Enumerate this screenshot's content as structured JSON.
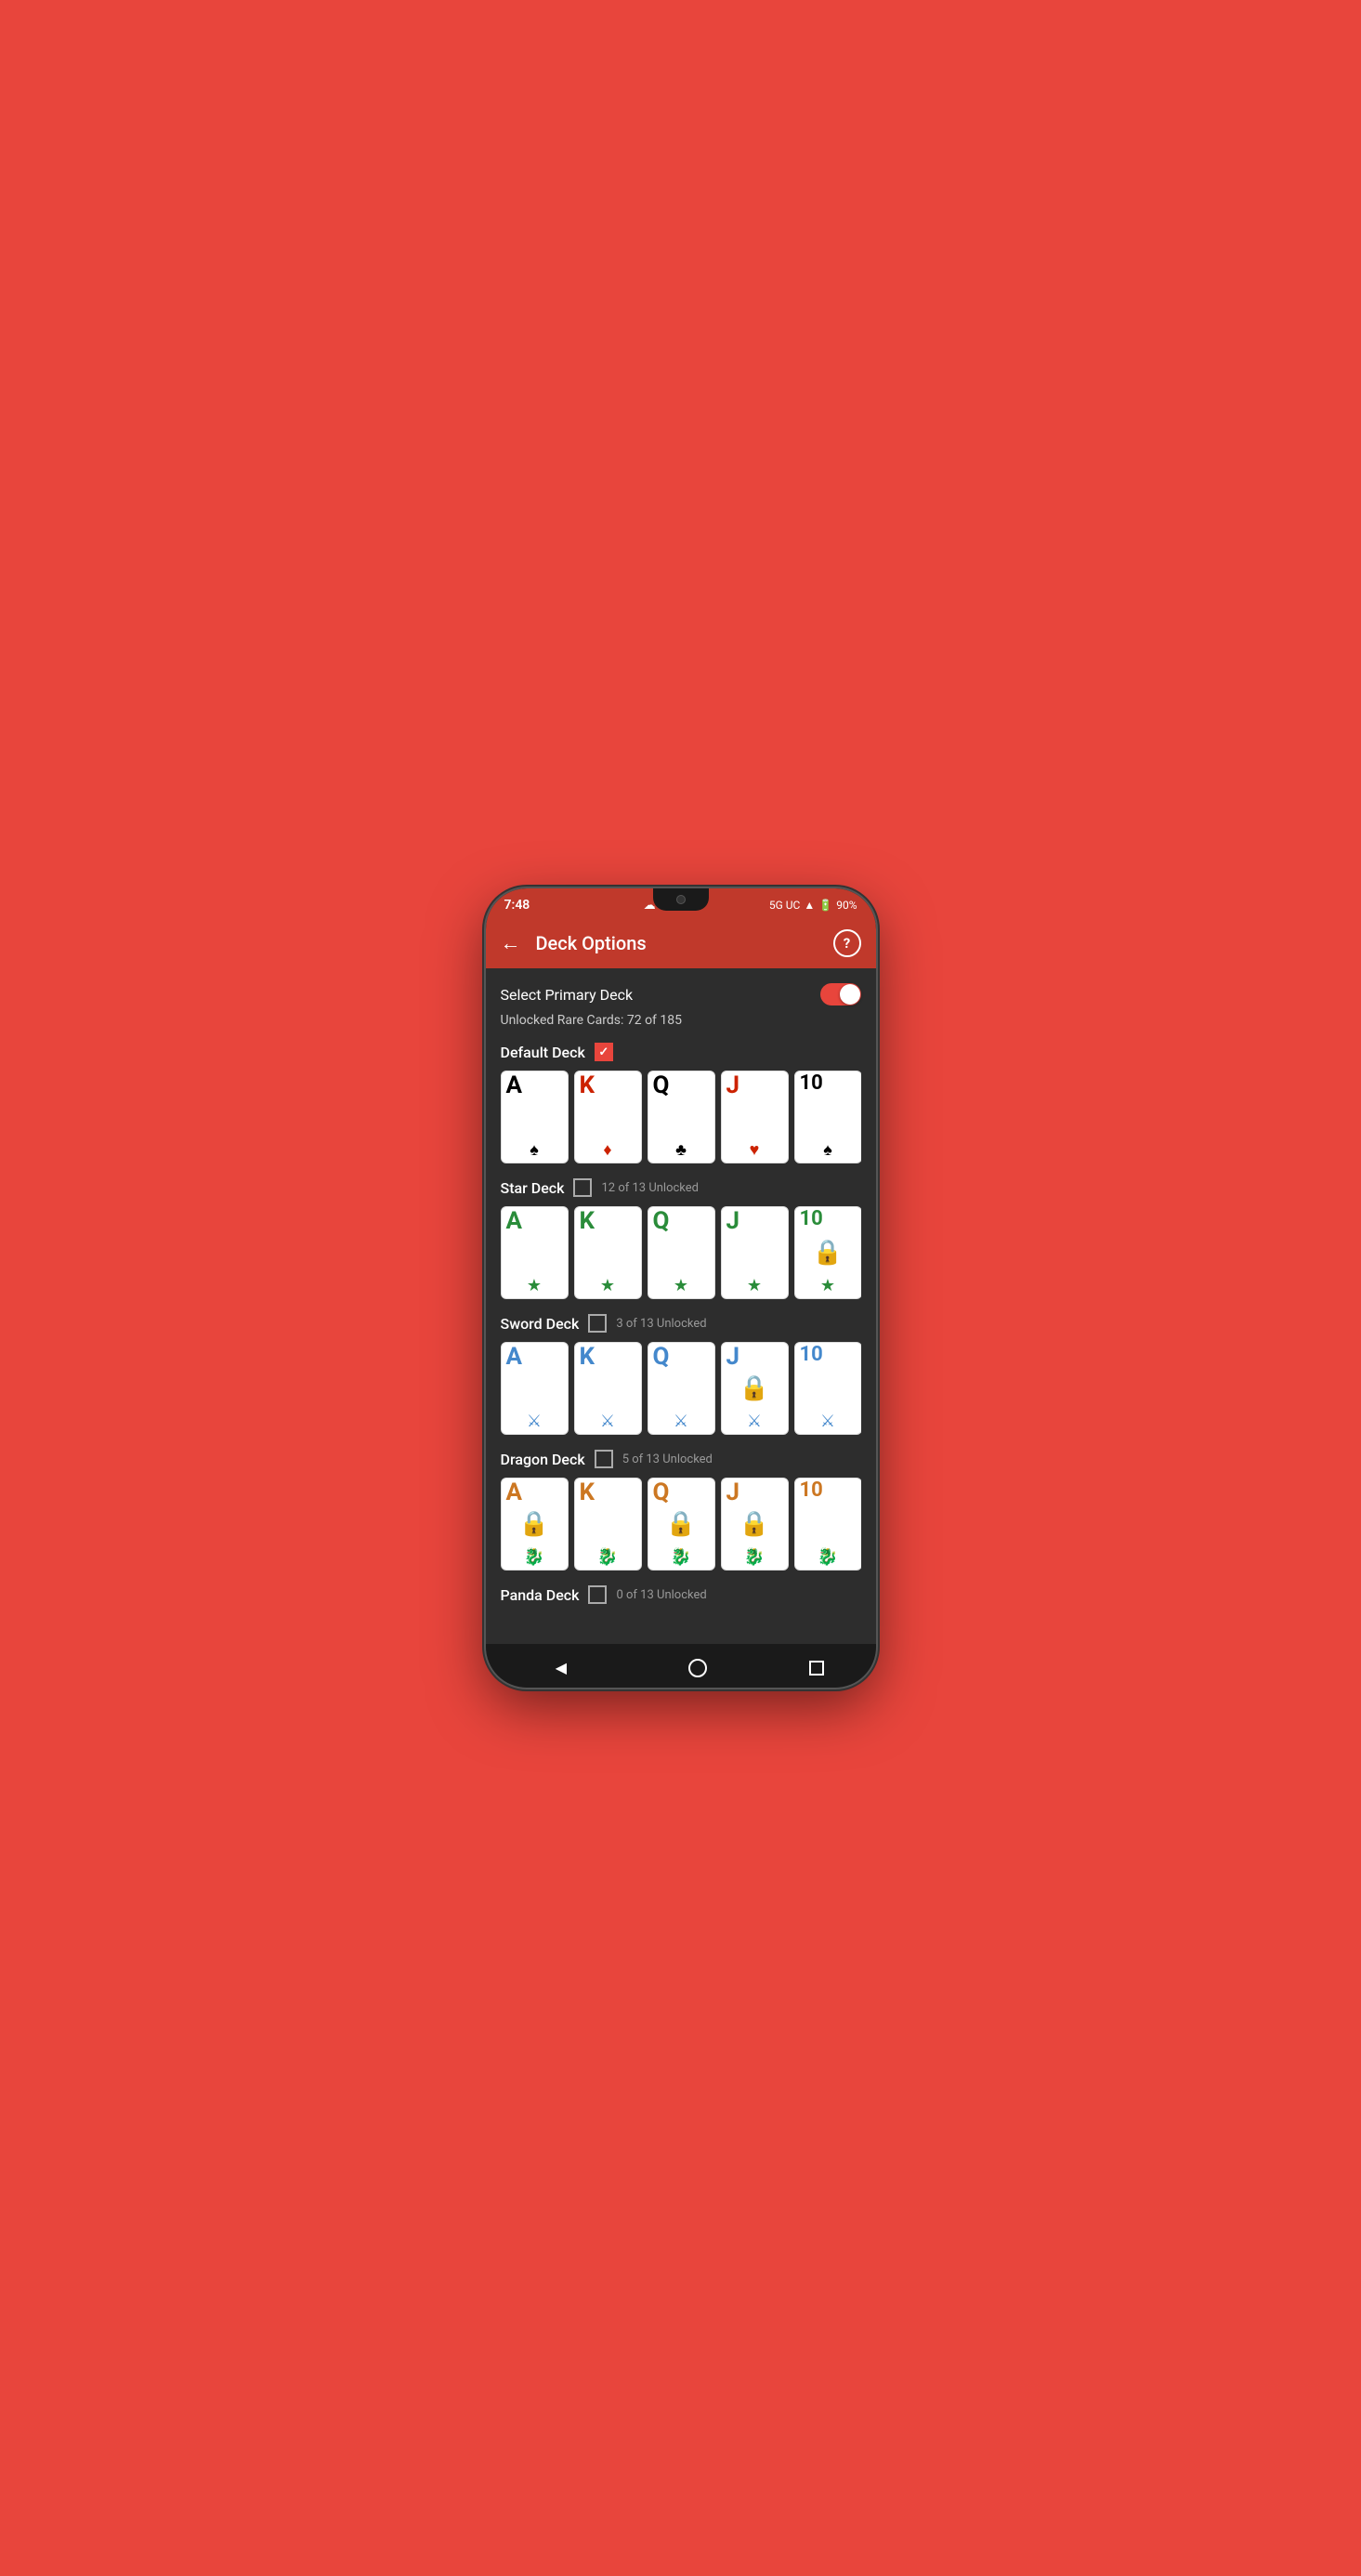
{
  "statusBar": {
    "time": "7:48",
    "network": "5G UC",
    "battery": "90%",
    "cloudIcon": "☁"
  },
  "appBar": {
    "title": "Deck Options",
    "backLabel": "←",
    "helpLabel": "?"
  },
  "selectPrimaryDeck": {
    "label": "Select Primary Deck",
    "toggleOn": true
  },
  "unlockedRare": {
    "label": "Unlocked Rare Cards: 72 of 185"
  },
  "decks": [
    {
      "name": "Default Deck",
      "checked": true,
      "unlockText": "",
      "cards": [
        {
          "letter": "A",
          "symbol": "♠",
          "color": "black",
          "locked": false,
          "value": ""
        },
        {
          "letter": "K",
          "symbol": "♦",
          "color": "red",
          "locked": false,
          "value": ""
        },
        {
          "letter": "Q",
          "symbol": "♣",
          "color": "black",
          "locked": false,
          "value": ""
        },
        {
          "letter": "J",
          "symbol": "♥",
          "color": "red",
          "locked": false,
          "value": ""
        },
        {
          "letter": "10",
          "symbol": "♠",
          "color": "black",
          "locked": false,
          "value": ""
        }
      ]
    },
    {
      "name": "Star Deck",
      "checked": false,
      "unlockText": "12 of 13 Unlocked",
      "cards": [
        {
          "letter": "A",
          "symbol": "★",
          "color": "green",
          "locked": false,
          "value": ""
        },
        {
          "letter": "K",
          "symbol": "★",
          "color": "green",
          "locked": false,
          "value": ""
        },
        {
          "letter": "Q",
          "symbol": "★",
          "color": "green",
          "locked": false,
          "value": ""
        },
        {
          "letter": "J",
          "symbol": "★",
          "color": "green",
          "locked": false,
          "value": ""
        },
        {
          "letter": "10",
          "symbol": "★",
          "color": "green",
          "locked": true,
          "value": ""
        }
      ]
    },
    {
      "name": "Sword Deck",
      "checked": false,
      "unlockText": "3 of 13 Unlocked",
      "cards": [
        {
          "letter": "A",
          "symbol": "𝕴",
          "color": "blue",
          "locked": false,
          "value": ""
        },
        {
          "letter": "K",
          "symbol": "𝕴",
          "color": "blue",
          "locked": false,
          "value": ""
        },
        {
          "letter": "Q",
          "symbol": "𝕴",
          "color": "blue",
          "locked": false,
          "value": ""
        },
        {
          "letter": "J",
          "symbol": "𝕴",
          "color": "blue",
          "locked": true,
          "value": ""
        },
        {
          "letter": "10",
          "symbol": "𝕴",
          "color": "blue",
          "locked": false,
          "value": ""
        }
      ]
    },
    {
      "name": "Dragon Deck",
      "checked": false,
      "unlockText": "5 of 13 Unlocked",
      "cards": [
        {
          "letter": "A",
          "symbol": "🐉",
          "color": "orange",
          "locked": true,
          "value": ""
        },
        {
          "letter": "K",
          "symbol": "🐉",
          "color": "orange",
          "locked": false,
          "value": ""
        },
        {
          "letter": "Q",
          "symbol": "🐉",
          "color": "orange",
          "locked": true,
          "value": ""
        },
        {
          "letter": "J",
          "symbol": "🐉",
          "color": "orange",
          "locked": true,
          "value": ""
        },
        {
          "letter": "10",
          "symbol": "🐉",
          "color": "orange",
          "locked": false,
          "value": ""
        }
      ]
    },
    {
      "name": "Panda Deck",
      "checked": false,
      "unlockText": "0 of 13 Unlocked",
      "cards": []
    }
  ],
  "bottomNav": {
    "back": "◀",
    "home": "⬤",
    "recents": "■"
  }
}
